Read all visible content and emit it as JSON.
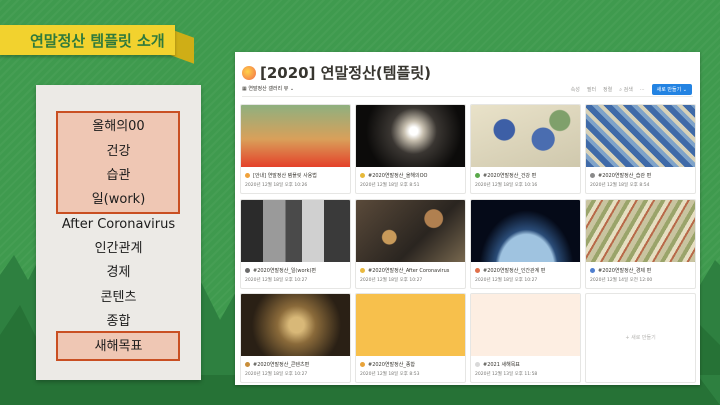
{
  "slide": {
    "title": "연말정산 템플릿 소개"
  },
  "menu": {
    "items": [
      "올해의00",
      "건강",
      "습관",
      "일(work)",
      "After Coronavirus",
      "인간관계",
      "경제",
      "콘텐츠",
      "종합",
      "새해목표"
    ]
  },
  "notion": {
    "title": "[2020] 연말정산(템플릿)",
    "view_label": "연말정산 갤러리 뷰 ⌄",
    "toolbar": {
      "properties": "속성",
      "filter": "필터",
      "sort": "정렬",
      "search": "검색",
      "more": "···",
      "new_button": "새로 만들기 ⌄"
    },
    "cards": [
      {
        "name": "[안내] 연말정산 템플릿 사용법",
        "date": "2020년 12월 18일 오후 10:26",
        "icon_color": "#f0a23c"
      },
      {
        "name": "#2020연말정산_올해의OO",
        "date": "2020년 12월 18일 오후 8:51",
        "icon_color": "#e6b93a"
      },
      {
        "name": "#2020연말정산_건강 편",
        "date": "2020년 12월 18일 오후 10:16",
        "icon_color": "#5aa94b"
      },
      {
        "name": "#2020연말정산_습관 편",
        "date": "2020년 12월 18일 오후 8:54",
        "icon_color": "#8a8a8a"
      },
      {
        "name": "#2020연말정산_일(work)편",
        "date": "2020년 12월 18일 오후 10:27",
        "icon_color": "#6b6b6b"
      },
      {
        "name": "#2020연말정산_After Coronavirus",
        "date": "2020년 12월 18일 오후 10:27",
        "icon_color": "#e9b93f"
      },
      {
        "name": "#2020연말정산_인간관계 편",
        "date": "2020년 12월 18일 오후 10:27",
        "icon_color": "#e0704a"
      },
      {
        "name": "#2020연말정산_경제 편",
        "date": "2020년 12월 14일 오전 12:00",
        "icon_color": "#4f7fcf"
      },
      {
        "name": "#2020연말정산_콘텐츠편",
        "date": "2020년 12월 18일 오후 10:27",
        "icon_color": "#c98e3a"
      },
      {
        "name": "#2020연말정산_종합",
        "date": "2020년 12월 18일 오후 8:53",
        "icon_color": "#e8a33a"
      },
      {
        "name": "#2021 새해목표",
        "date": "2020년 12월 13일 오후 11:58",
        "icon_color": "#d9d9d9"
      }
    ],
    "new_page_label": "+ 새로 만들기"
  },
  "colors": {
    "background": "#3f9a4e",
    "banner": "#f2d22e",
    "highlight": "#efc7b4",
    "highlight_border": "#c94f22",
    "notion_blue": "#2383e2"
  }
}
